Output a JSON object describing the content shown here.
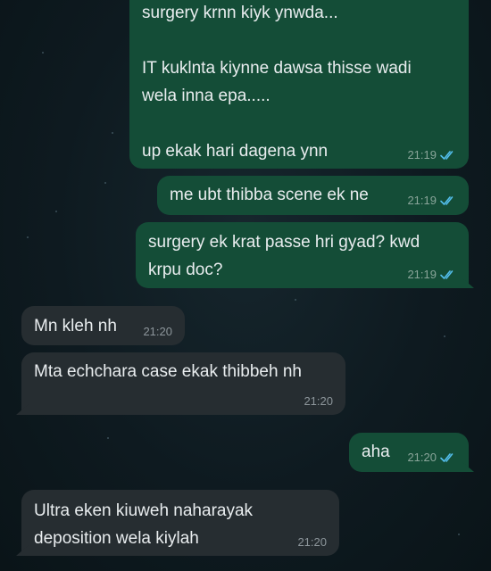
{
  "messages": [
    {
      "text": "surgery krnn kiyk ynwda...\n\nIT kuklnta kiynne dawsa thisse wadi\nwela inna epa.....\n\nup ekak hari dagena ynn",
      "time": "21:19"
    },
    {
      "text": "me ubt thibba scene ek ne",
      "time": "21:19"
    },
    {
      "text": "surgery ek krat passe hri gyad? kwd\nkrpu doc?",
      "time": "21:19"
    },
    {
      "text": "Mn kleh nh",
      "time": "21:20"
    },
    {
      "text": "Mta echchara case ekak thibbeh nh",
      "time": "21:20"
    },
    {
      "text": "aha",
      "time": "21:20"
    },
    {
      "text": "Ultra eken kiuweh naharayak\ndeposition wela kiylah",
      "time": "21:20"
    }
  ],
  "colors": {
    "outgoing_bubble": "#144d37",
    "incoming_bubble": "#262d31",
    "read_ticks": "#53bdeb",
    "background": "#0e1a20"
  }
}
